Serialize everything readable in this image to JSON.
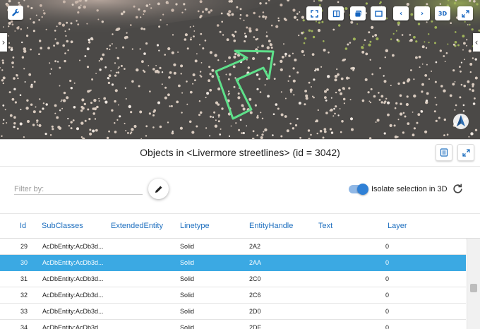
{
  "viewer": {
    "toolbar": [
      {
        "name": "fit-view-button",
        "icon": "fit-view-icon",
        "label": ""
      },
      {
        "name": "frame-button",
        "icon": "frame-icon",
        "label": ""
      },
      {
        "name": "layers-button",
        "icon": "layers-icon",
        "label": ""
      },
      {
        "name": "window-button",
        "icon": "window-icon",
        "label": ""
      },
      {
        "name": "previous-button",
        "icon": "chevron-left-icon",
        "label": "‹"
      },
      {
        "name": "next-button",
        "icon": "chevron-right-icon",
        "label": "›"
      },
      {
        "name": "view-3d-button",
        "icon": "3d-icon",
        "label": "3D"
      },
      {
        "name": "fullscreen-button",
        "icon": "expand-icon",
        "label": ""
      }
    ],
    "left_arrow": "‹",
    "right_arrow": "‹",
    "accent": "#5ee08a"
  },
  "panel": {
    "title": "Objects in <Livermore streetlines> (id = 3042)"
  },
  "filter": {
    "placeholder": "Filter by:",
    "value": "",
    "isolate_label": "Isolate selection in 3D",
    "isolate_on": true
  },
  "table": {
    "columns": [
      "Id",
      "SubClasses",
      "ExtendedEntity",
      "Linetype",
      "EntityHandle",
      "Text",
      "Layer"
    ],
    "rows": [
      {
        "id": "29",
        "subclasses": "AcDbEntity:AcDb3d...",
        "extended": "",
        "linetype": "Solid",
        "handle": "2A2",
        "text": "",
        "layer": "0",
        "selected": false
      },
      {
        "id": "30",
        "subclasses": "AcDbEntity:AcDb3d...",
        "extended": "",
        "linetype": "Solid",
        "handle": "2AA",
        "text": "",
        "layer": "0",
        "selected": true
      },
      {
        "id": "31",
        "subclasses": "AcDbEntity:AcDb3d...",
        "extended": "",
        "linetype": "Solid",
        "handle": "2C0",
        "text": "",
        "layer": "0",
        "selected": false
      },
      {
        "id": "32",
        "subclasses": "AcDbEntity:AcDb3d...",
        "extended": "",
        "linetype": "Solid",
        "handle": "2C6",
        "text": "",
        "layer": "0",
        "selected": false
      },
      {
        "id": "33",
        "subclasses": "AcDbEntity:AcDb3d...",
        "extended": "",
        "linetype": "Solid",
        "handle": "2D0",
        "text": "",
        "layer": "0",
        "selected": false
      },
      {
        "id": "34",
        "subclasses": "AcDbEntity:AcDb3d...",
        "extended": "",
        "linetype": "Solid",
        "handle": "2DF",
        "text": "",
        "layer": "0",
        "selected": false
      }
    ]
  },
  "colors": {
    "selection": "#3ba9e3",
    "header_text": "#1e6fbf",
    "toggle": "#2f80d6"
  }
}
